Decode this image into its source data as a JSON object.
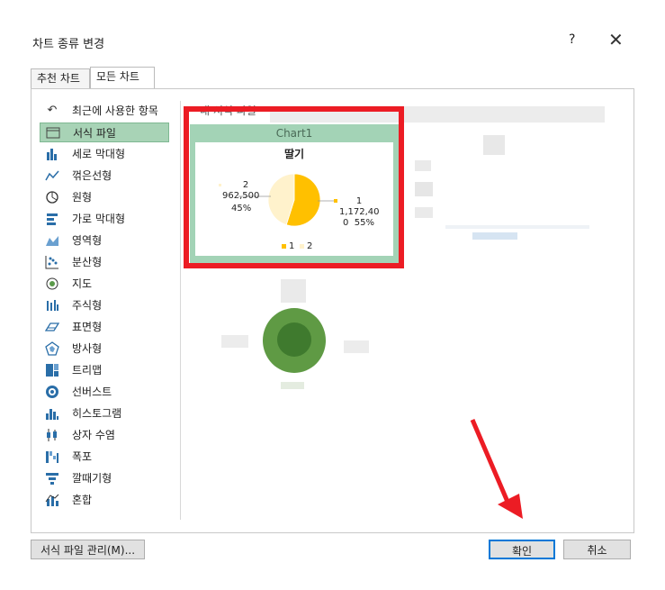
{
  "dialog": {
    "title": "차트 종류 변경",
    "help": "?",
    "close": "✕"
  },
  "tabs": [
    {
      "label": "추천 차트"
    },
    {
      "label": "모든 차트"
    }
  ],
  "sidebar": {
    "items": [
      {
        "label": "최근에 사용한 항목",
        "icon": "recent-icon"
      },
      {
        "label": "서식 파일",
        "icon": "folder-icon"
      },
      {
        "label": "세로 막대형",
        "icon": "column-chart-icon"
      },
      {
        "label": "꺾은선형",
        "icon": "line-chart-icon"
      },
      {
        "label": "원형",
        "icon": "pie-chart-icon"
      },
      {
        "label": "가로 막대형",
        "icon": "bar-chart-icon"
      },
      {
        "label": "영역형",
        "icon": "area-chart-icon"
      },
      {
        "label": "분산형",
        "icon": "scatter-chart-icon"
      },
      {
        "label": "지도",
        "icon": "map-chart-icon"
      },
      {
        "label": "주식형",
        "icon": "stock-chart-icon"
      },
      {
        "label": "표면형",
        "icon": "surface-chart-icon"
      },
      {
        "label": "방사형",
        "icon": "radar-chart-icon"
      },
      {
        "label": "트리맵",
        "icon": "treemap-chart-icon"
      },
      {
        "label": "선버스트",
        "icon": "sunburst-chart-icon"
      },
      {
        "label": "히스토그램",
        "icon": "histogram-chart-icon"
      },
      {
        "label": "상자 수염",
        "icon": "boxplot-chart-icon"
      },
      {
        "label": "폭포",
        "icon": "waterfall-chart-icon"
      },
      {
        "label": "깔때기형",
        "icon": "funnel-chart-icon"
      },
      {
        "label": "혼합",
        "icon": "combo-chart-icon"
      }
    ],
    "selected_index": 1
  },
  "main": {
    "section_title": "내 서식 파일",
    "template": {
      "name": "Chart1",
      "chart_title": "딸기",
      "labels": {
        "slice2": [
          "2",
          "962,500",
          "45%"
        ],
        "slice1": [
          "1",
          "1,172,40",
          "0  55%"
        ]
      },
      "legend": [
        "1",
        "2"
      ]
    }
  },
  "chart_data": {
    "type": "pie",
    "title": "딸기",
    "categories": [
      "1",
      "2"
    ],
    "values": [
      1172400,
      962500
    ],
    "percent": [
      55,
      45
    ],
    "colors": [
      "#ffc000",
      "#fff2cc"
    ]
  },
  "footer": {
    "manage_button": "서식 파일 관리(M)...",
    "ok_button": "확인",
    "cancel_button": "취소"
  },
  "colors": {
    "selected_bg": "#a8d3b6",
    "template_card": "#a3d3b6",
    "highlight_border": "#ec1c24",
    "annotation_arrow": "#ec1c24",
    "ok_border": "#0078d7"
  }
}
